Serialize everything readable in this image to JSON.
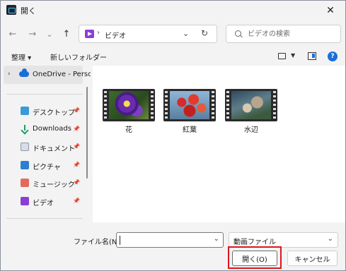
{
  "window": {
    "title": "開く",
    "close_label": "✕"
  },
  "nav": {
    "back": "←",
    "forward": "→",
    "history": "⌄",
    "up": "↑",
    "address": {
      "separator": "›",
      "path": "ビデオ",
      "dropdown": "⌄",
      "refresh": "↻"
    },
    "search": {
      "placeholder": "ビデオの検索"
    }
  },
  "command_bar": {
    "organize": "整理 ▾",
    "new_folder": "新しいフォルダー",
    "view_dropdown": "▼",
    "help": "?"
  },
  "sidebar": {
    "top": {
      "chevron": "›",
      "label": "OneDrive - Perso"
    },
    "pin_glyph": "📌",
    "items": [
      {
        "label": "デスクトップ",
        "icon": "desktop-icon"
      },
      {
        "label": "Downloads",
        "icon": "download-icon"
      },
      {
        "label": "ドキュメント",
        "icon": "documents-icon"
      },
      {
        "label": "ピクチャ",
        "icon": "pictures-icon"
      },
      {
        "label": "ミュージック",
        "icon": "music-icon"
      },
      {
        "label": "ビデオ",
        "icon": "video-icon"
      }
    ]
  },
  "files": [
    {
      "name": "花"
    },
    {
      "name": "紅葉"
    },
    {
      "name": "水辺"
    }
  ],
  "footer": {
    "filename_label": "ファイル名(N):",
    "filename_value": "",
    "filename_dropdown": "⌄",
    "filetype_value": "動画ファイル",
    "filetype_dropdown": "⌄",
    "open_label": "開く(O)",
    "cancel_label": "キャンセル"
  },
  "colors": {
    "highlight": "#e0141e",
    "accent": "#1a6fd6",
    "video": "#8a3ed6"
  }
}
